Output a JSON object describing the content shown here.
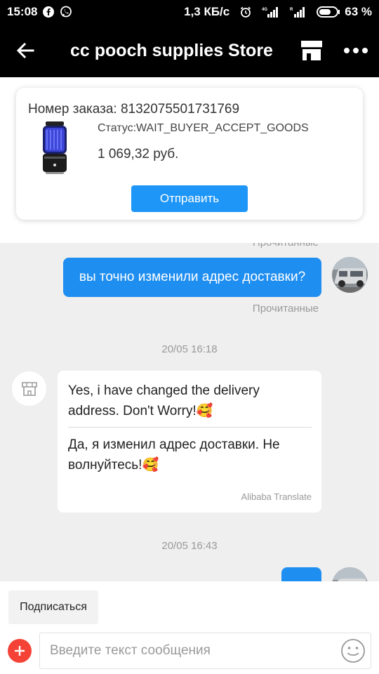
{
  "status_bar": {
    "time": "15:08",
    "network_speed": "1,3 КБ/с",
    "battery_percent": "63 %",
    "icons": [
      "facebook-icon",
      "viber-icon",
      "alarm-icon",
      "signal-4g-icon",
      "signal-r-icon",
      "battery-icon"
    ]
  },
  "header": {
    "title": "cc pooch supplies Store",
    "icons": [
      "back-arrow-icon",
      "store-icon",
      "more-icon"
    ]
  },
  "order": {
    "number_label": "Номер заказа: 8132075501731769",
    "status": "Статус:WAIT_BUYER_ACCEPT_GOODS",
    "price": "1 069,32 руб.",
    "send_button": "Отправить"
  },
  "chat": {
    "read_status_top": "Прочитанные",
    "outgoing_message": "вы точно изменили адрес доставки?",
    "read_status": "Прочитанные",
    "timestamp_1": "20/05 16:18",
    "incoming_original": "Yes, i have changed the delivery address. Don't Worry!🥰",
    "incoming_translation": "Да, я изменил адрес доставки. Не волнуйтесь!🥰",
    "translate_credit": "Alibaba Translate",
    "timestamp_2": "20/05 16:43"
  },
  "bottom": {
    "subscribe_button": "Подписаться",
    "input_placeholder": "Введите текст сообщения"
  },
  "colors": {
    "header_bg": "#000000",
    "accent_blue": "#1e96f7",
    "bubble_blue": "#1f8ef1",
    "chat_bg": "#efefef",
    "plus_red": "#f44336"
  }
}
